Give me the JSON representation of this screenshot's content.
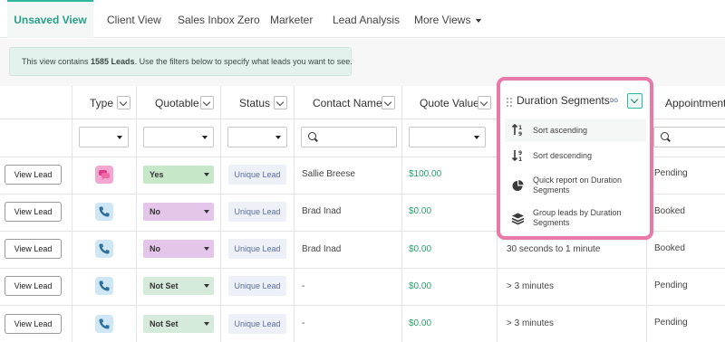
{
  "tabs": [
    {
      "label": "Unsaved View",
      "active": true
    },
    {
      "label": "Client View"
    },
    {
      "label": "Sales Inbox Zero"
    },
    {
      "label": "Marketer"
    },
    {
      "label": "Lead Analysis"
    },
    {
      "label": "More Views"
    }
  ],
  "banner": {
    "prefix": "This view contains ",
    "count": "1585 Leads",
    "suffix": ". Use the filters below to specify what leads you want to see."
  },
  "columns": {
    "type": "Type",
    "quotable": "Quotable",
    "status": "Status",
    "contact_name": "Contact Name",
    "quote_value": "Quote Value",
    "duration_segments": "Duration Segments",
    "appointment": "Appointment"
  },
  "rows": [
    {
      "action": "View Lead",
      "type": "chat",
      "quotable": "Yes",
      "status": "Unique Lead",
      "contact": "Sallie Breese",
      "value": "$100.00",
      "duration": "",
      "appointment": "Pending"
    },
    {
      "action": "View Lead",
      "type": "phone",
      "quotable": "No",
      "status": "Unique Lead",
      "contact": "Brad Inad",
      "value": "$0.00",
      "duration": "",
      "appointment": "Booked"
    },
    {
      "action": "View Lead",
      "type": "phone",
      "quotable": "No",
      "status": "Unique Lead",
      "contact": "Brad Inad",
      "value": "$0.00",
      "duration": "30 seconds to 1 minute",
      "appointment": "Booked"
    },
    {
      "action": "View Lead",
      "type": "phone",
      "quotable": "Not Set",
      "status": "Unique Lead",
      "contact": "-",
      "value": "$0.00",
      "duration": "> 3 minutes",
      "appointment": "Pending"
    },
    {
      "action": "View Lead",
      "type": "phone",
      "quotable": "Not Set",
      "status": "Unique Lead",
      "contact": "-",
      "value": "$0.00",
      "duration": "> 3 minutes",
      "appointment": "Pending"
    }
  ],
  "menu": {
    "title": "Duration Segments",
    "badge": "DG",
    "items": [
      {
        "label_line1": "Sort ascending",
        "label_line2": "",
        "icon": "sort-ascending-icon"
      },
      {
        "label_line1": "Sort descending",
        "label_line2": "",
        "icon": "sort-descending-icon"
      },
      {
        "label_line1": "Quick report on Duration",
        "label_line2": "Segments",
        "icon": "pie-chart-icon"
      },
      {
        "label_line1": "Group leads by Duration",
        "label_line2": "Segments",
        "icon": "layers-icon"
      }
    ]
  },
  "colors": {
    "accent": "#2fb79d",
    "highlight_border": "#e87aa9",
    "money": "#28a06b",
    "status_text": "#5c6e9e"
  }
}
